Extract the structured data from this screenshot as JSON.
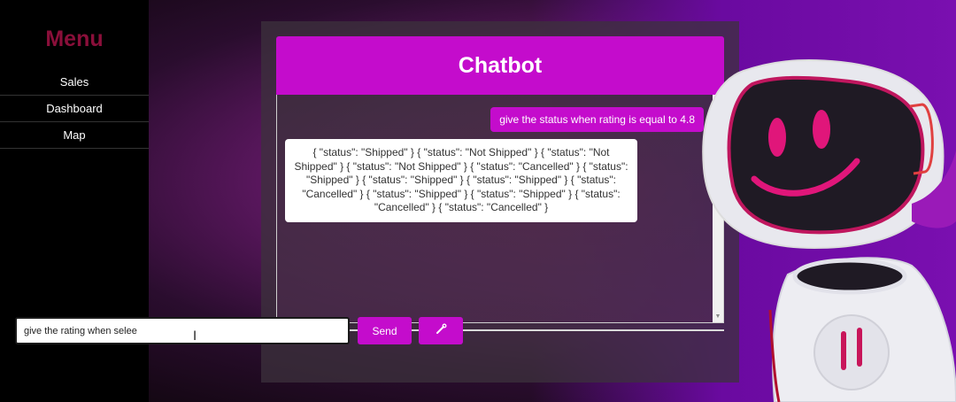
{
  "sidebar": {
    "title": "Menu",
    "items": [
      {
        "label": "Sales"
      },
      {
        "label": "Dashboard"
      },
      {
        "label": "Map"
      }
    ]
  },
  "chatbot": {
    "title": "Chatbot",
    "messages": {
      "user": "give the status when rating is equal to 4.8",
      "bot": "{ \"status\": \"Shipped\" } { \"status\": \"Not Shipped\" } { \"status\": \"Not Shipped\" } { \"status\": \"Not Shipped\" } { \"status\": \"Cancelled\" } { \"status\": \"Shipped\" } { \"status\": \"Shipped\" } { \"status\": \"Shipped\" } { \"status\": \"Cancelled\" } { \"status\": \"Shipped\" } { \"status\": \"Shipped\" } { \"status\": \"Cancelled\" } { \"status\": \"Cancelled\" }"
    },
    "input": {
      "value": "give the rating when selee"
    },
    "send_label": "Send",
    "mic_icon": "microphone-icon"
  },
  "colors": {
    "accent": "#c40ccc",
    "menu_title": "#8a0f3a",
    "sidebar_bg": "#000000"
  }
}
